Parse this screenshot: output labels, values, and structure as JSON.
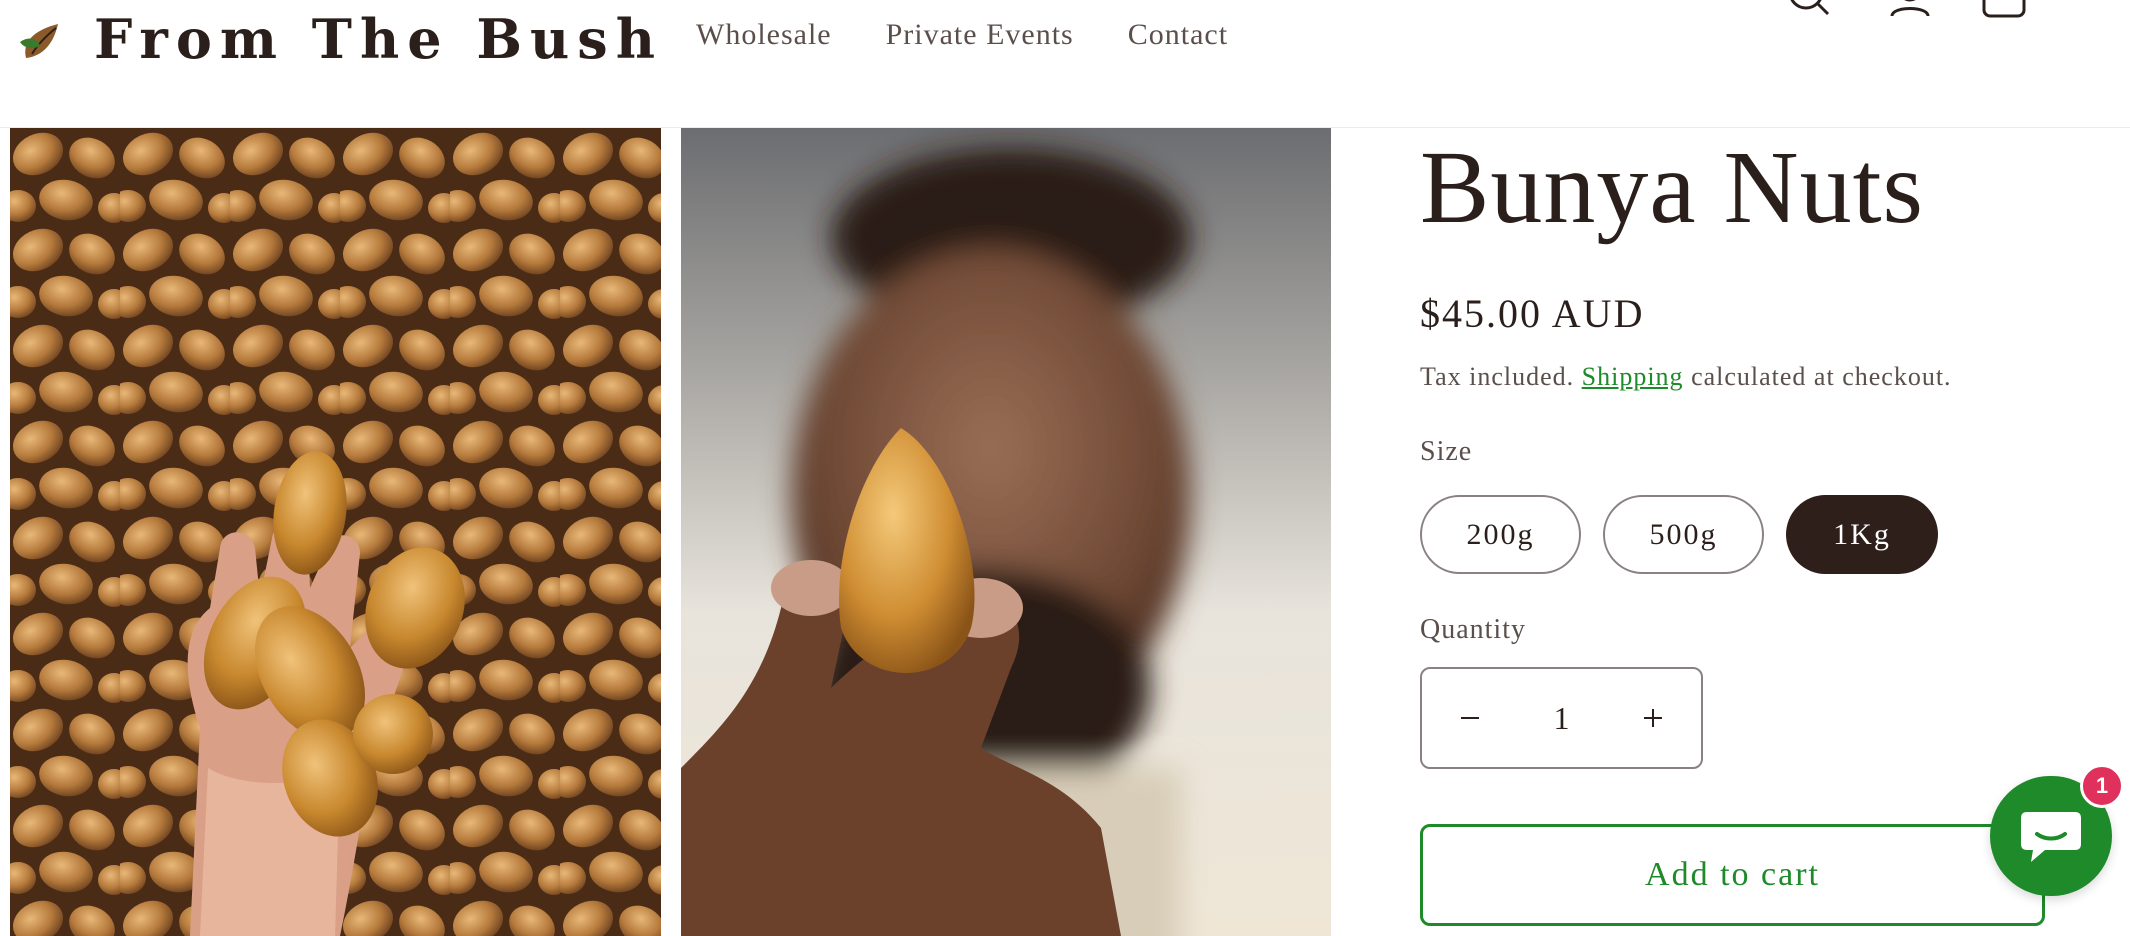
{
  "brand": {
    "name": "From The Bush",
    "logo_icon": "leaf-logo-icon"
  },
  "nav": {
    "items": [
      {
        "label": "Wholesale"
      },
      {
        "label": "Private Events"
      },
      {
        "label": "Contact"
      }
    ]
  },
  "header_icons": [
    "search-icon",
    "account-icon",
    "cart-icon"
  ],
  "product": {
    "title": "Bunya Nuts",
    "price": "$45.00 AUD",
    "tax_prefix": "Tax included.",
    "shipping_link": "Shipping",
    "tax_suffix": "calculated at checkout.",
    "size_label": "Size",
    "sizes": [
      {
        "label": "200g",
        "selected": false
      },
      {
        "label": "500g",
        "selected": false
      },
      {
        "label": "1Kg",
        "selected": true
      }
    ],
    "quantity_label": "Quantity",
    "quantity": "1",
    "add_to_cart": "Add to cart"
  },
  "chat": {
    "badge_count": "1"
  },
  "colors": {
    "brand_dark": "#2f1f1b",
    "accent_green": "#1e8a2a",
    "badge_red": "#e0315c"
  }
}
